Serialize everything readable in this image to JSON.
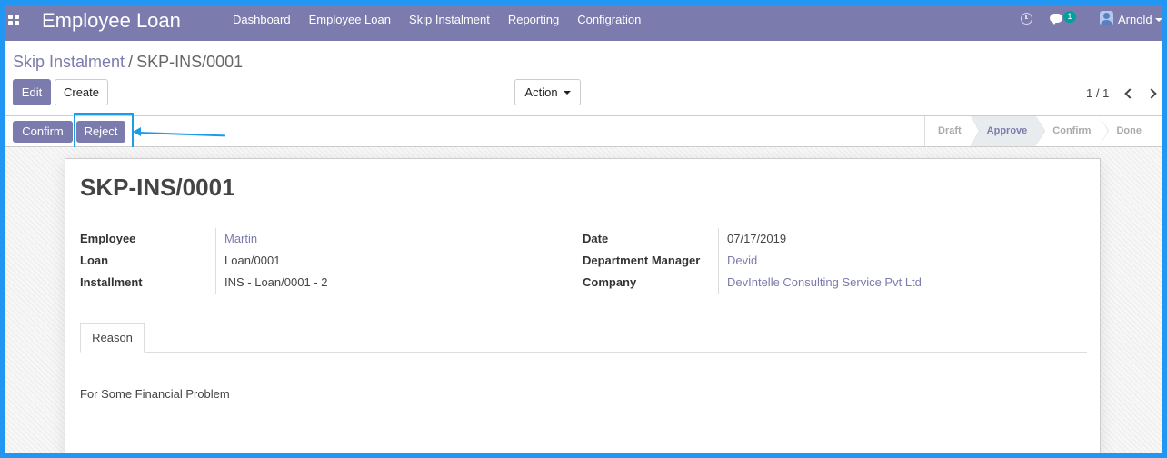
{
  "navbar": {
    "app_title": "Employee Loan",
    "menu": [
      {
        "label": "Dashboard"
      },
      {
        "label": "Employee Loan"
      },
      {
        "label": "Skip Instalment"
      },
      {
        "label": "Reporting"
      },
      {
        "label": "Configration"
      }
    ],
    "chat_count": "1",
    "user_name": "Arnold",
    "icons": [
      "apps-icon",
      "clock-icon",
      "chat-icon",
      "avatar"
    ]
  },
  "breadcrumb": {
    "parent": "Skip Instalment",
    "separator": "/",
    "current": "SKP-INS/0001"
  },
  "control": {
    "edit_label": "Edit",
    "create_label": "Create",
    "action_label": "Action",
    "pager": "1 / 1"
  },
  "statusbar": {
    "confirm_label": "Confirm",
    "reject_label": "Reject",
    "stages": [
      {
        "label": "Draft",
        "active": false
      },
      {
        "label": "Approve",
        "active": true
      },
      {
        "label": "Confirm",
        "active": false
      },
      {
        "label": "Done",
        "active": false
      }
    ]
  },
  "form": {
    "title": "SKP-INS/0001",
    "left_fields": [
      {
        "label": "Employee",
        "value": "Martin",
        "link": true
      },
      {
        "label": "Loan",
        "value": "Loan/0001",
        "link": false
      },
      {
        "label": "Installment",
        "value": "INS - Loan/0001 - 2",
        "link": false
      }
    ],
    "right_fields": [
      {
        "label": "Date",
        "value": "07/17/2019",
        "link": false
      },
      {
        "label": "Department Manager",
        "value": "Devid",
        "link": true
      },
      {
        "label": "Company",
        "value": "DevIntelle Consulting Service Pvt Ltd",
        "link": true
      }
    ],
    "tab_label": "Reason",
    "reason_text": "For Some Financial Problem"
  },
  "colors": {
    "primary": "#7c7bad",
    "annotation": "#1e9be8",
    "frame": "#2196f3"
  }
}
